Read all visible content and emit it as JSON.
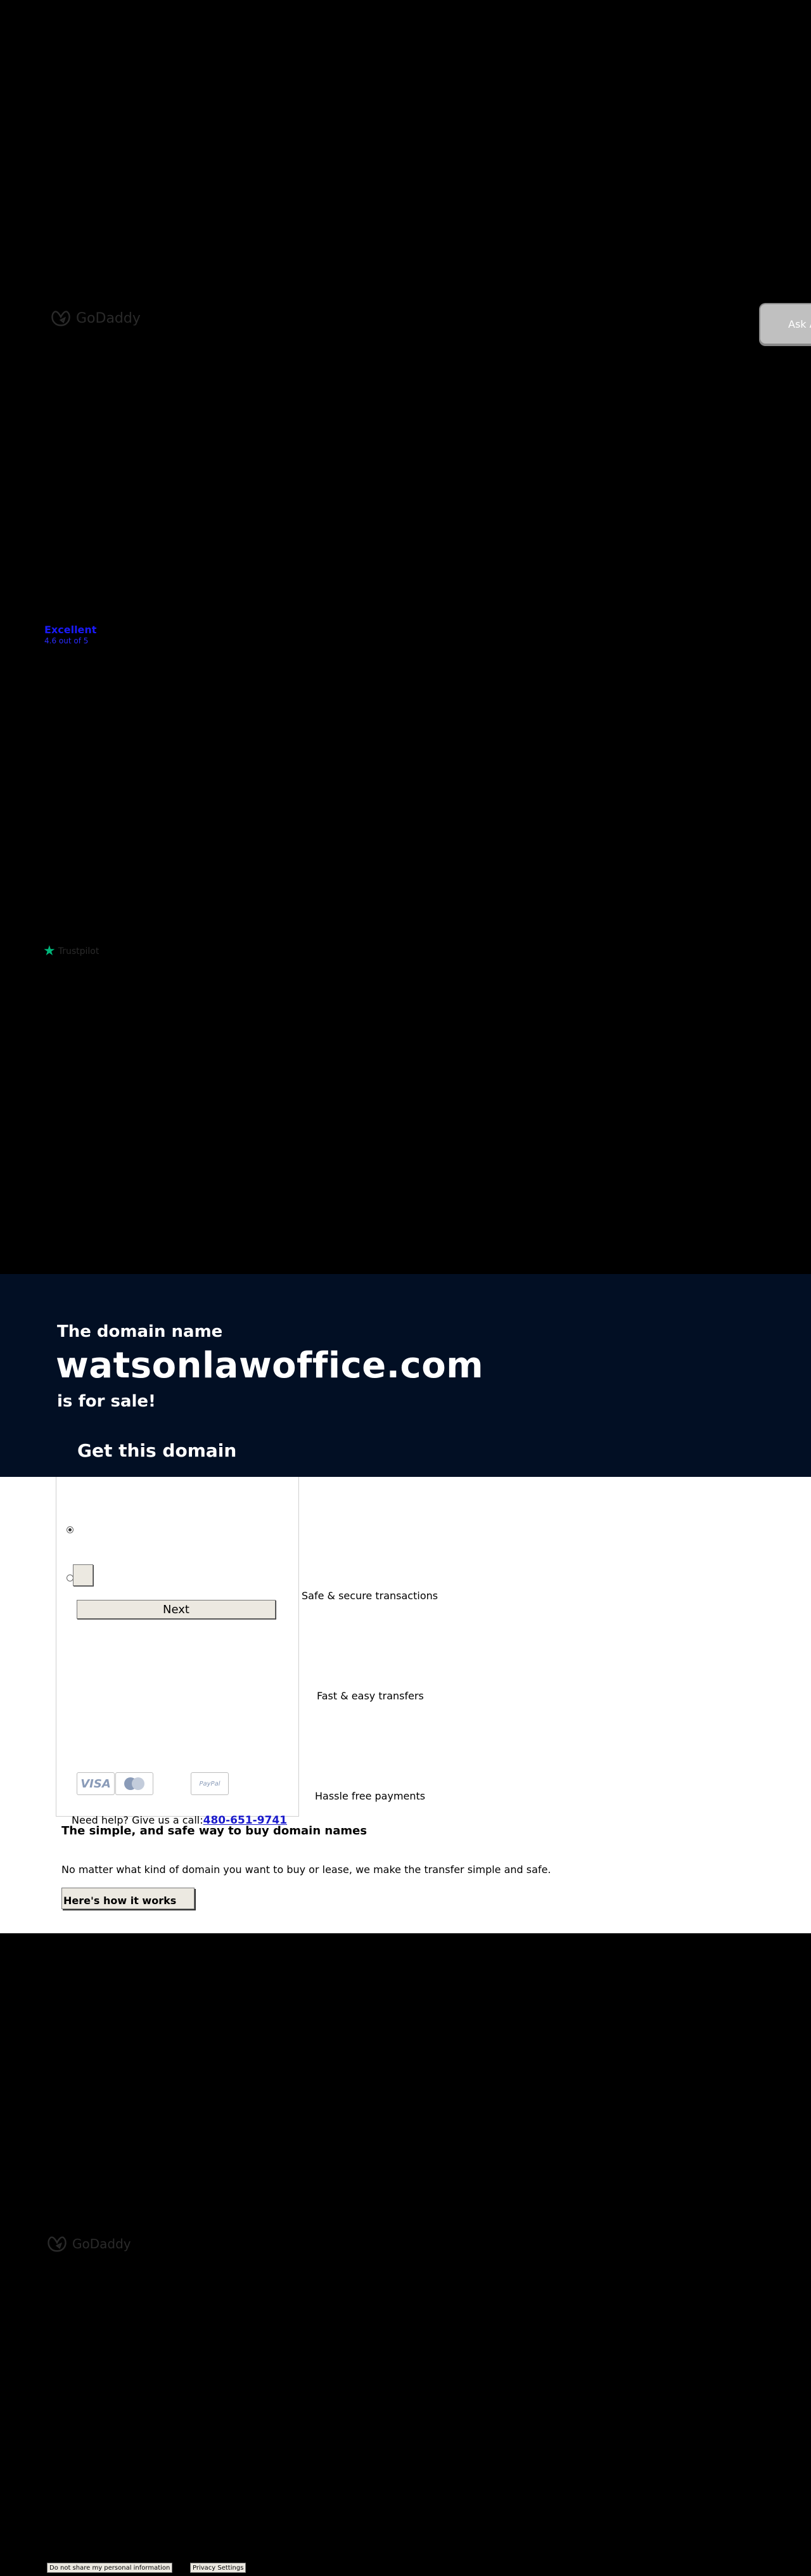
{
  "brand": {
    "name": "GoDaddy",
    "name_footer": "GoDaddy",
    "logo_icon": "godaddy-logo-icon"
  },
  "ask_button": {
    "label": "Ask A"
  },
  "rating": {
    "label": "Excellent",
    "sublabel": "4.6 out of 5"
  },
  "trustpilot": {
    "label": "Trustpilot",
    "icon": "star-icon",
    "star_color": "#00b67a"
  },
  "hero": {
    "pre": "The domain name",
    "domain": "watsonlawoffice.com",
    "post": "is for sale!",
    "cta": "Get this domain",
    "background": "#020f24"
  },
  "form": {
    "next_label": "Next",
    "payment_icons": [
      "visa-icon",
      "mastercard-icon",
      "paypal-icon"
    ],
    "visa_text": "VISA",
    "paypal_text": "PayPal"
  },
  "help": {
    "text": "Need help? Give us a call:",
    "phone": "480-651-9741"
  },
  "features": [
    {
      "label": "Safe & secure transactions",
      "icon": "shield-icon"
    },
    {
      "label": "Fast & easy transfers",
      "icon": "transfer-icon"
    },
    {
      "label": "Hassle free payments",
      "icon": "payment-icon"
    }
  ],
  "simple": {
    "title": "The simple, and safe way to buy domain names",
    "body": "No matter what kind of domain you want to buy or lease, we make the transfer simple and safe.",
    "button": "Here's how it works"
  },
  "footer": {
    "do_not_share": "Do not share my personal information",
    "privacy": "Privacy Settings"
  }
}
